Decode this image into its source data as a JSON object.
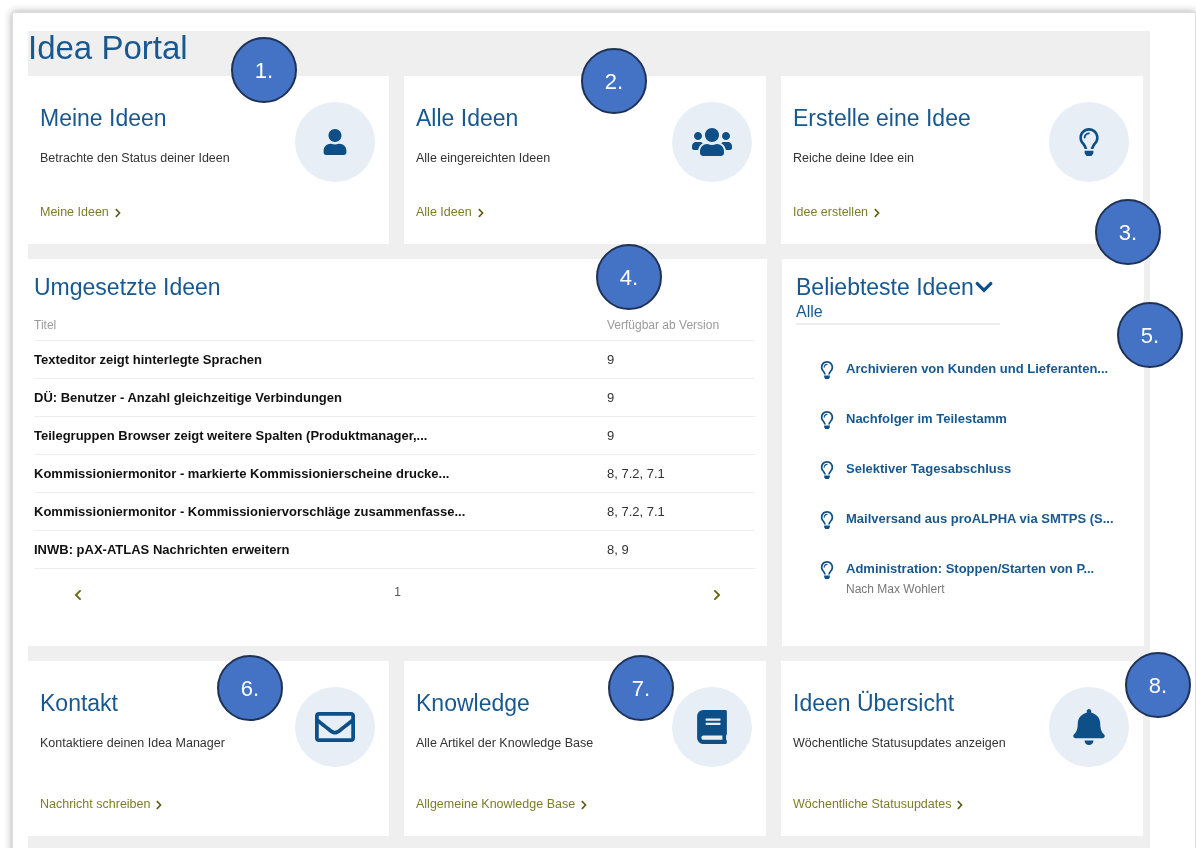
{
  "title": "Idea Portal",
  "top_cards": [
    {
      "kind": "user",
      "title": "Meine Ideen",
      "description": "Betrachte den Status deiner Ideen",
      "link": "Meine Ideen"
    },
    {
      "kind": "users",
      "title": "Alle Ideen",
      "description": "Alle eingereichten Ideen",
      "link": "Alle Ideen"
    },
    {
      "kind": "bulb",
      "title": "Erstelle eine Idee",
      "description": "Reiche deine Idee ein",
      "link": "Idee erstellen"
    }
  ],
  "implemented": {
    "title": "Umgesetzte Ideen",
    "columns": [
      "Titel",
      "Verfügbar ab Version"
    ],
    "rows": [
      {
        "title": "Texteditor zeigt hinterlegte Sprachen",
        "version": "9"
      },
      {
        "title": "DÜ: Benutzer - Anzahl gleichzeitige Verbindungen",
        "version": "9"
      },
      {
        "title": "Teilegruppen Browser zeigt weitere Spalten (Produktmanager,...",
        "version": "9"
      },
      {
        "title": "Kommissioniermonitor - markierte Kommissionierscheine drucke...",
        "version": "8, 7.2, 7.1"
      },
      {
        "title": "Kommissioniermonitor - Kommissioniervorschläge zusammenfasse...",
        "version": "8, 7.2, 7.1"
      },
      {
        "title": "INWB: pAX-ATLAS Nachrichten erweitern",
        "version": "8, 9"
      }
    ],
    "page": "1"
  },
  "popular": {
    "title": "Beliebteste Ideen",
    "filter": "Alle",
    "items": [
      {
        "title": "Archivieren von Kunden und Lieferanten..."
      },
      {
        "title": "Nachfolger im Teilestamm"
      },
      {
        "title": "Selektiver Tagesabschluss"
      },
      {
        "title": "Mailversand aus proALPHA via SMTPS (S..."
      },
      {
        "title": "Administration: Stoppen/Starten von P...",
        "author": "Nach Max Wohlert"
      }
    ]
  },
  "bottom_cards": [
    {
      "kind": "mail",
      "title": "Kontakt",
      "description": "Kontaktiere deinen Idea Manager",
      "link": "Nachricht schreiben"
    },
    {
      "kind": "book",
      "title": "Knowledge",
      "description": "Alle Artikel der Knowledge Base",
      "link": "Allgemeine Knowledge Base"
    },
    {
      "kind": "bell",
      "title": "Ideen Übersicht",
      "description": "Wöchentliche Statusupdates anzeigen",
      "link": "Wöchentliche Statusupdates"
    }
  ],
  "callouts": [
    "1.",
    "2.",
    "3.",
    "4.",
    "5.",
    "6.",
    "7.",
    "8."
  ]
}
